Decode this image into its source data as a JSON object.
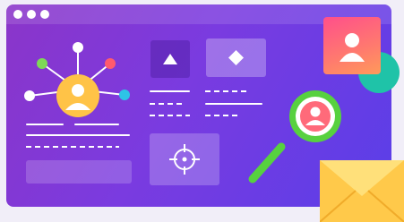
{
  "illustration": {
    "window": {
      "titlebar_dots": [
        "window-dot-1",
        "window-dot-2",
        "window-dot-3"
      ]
    },
    "icons": {
      "network": "network-hub-icon",
      "triangle": "triangle-icon",
      "diamond": "diamond-icon",
      "crosshair": "crosshair-icon",
      "profile_card": "profile-card-icon",
      "magnifier": "magnifier-icon",
      "envelope": "envelope-icon"
    },
    "colors": {
      "window_start": "#8b35c9",
      "window_end": "#5a3ee8",
      "avatar_yellow": "#ffc347",
      "node_green": "#7ed957",
      "node_red": "#ff5a6e",
      "node_cyan": "#2ec4e6",
      "magnifier_green": "#57d13f",
      "card_pink": "#ff4f8b",
      "card_orange": "#ff9a5a",
      "envelope_yellow": "#ffd25e",
      "teal_blob": "#1fc3a8"
    }
  }
}
